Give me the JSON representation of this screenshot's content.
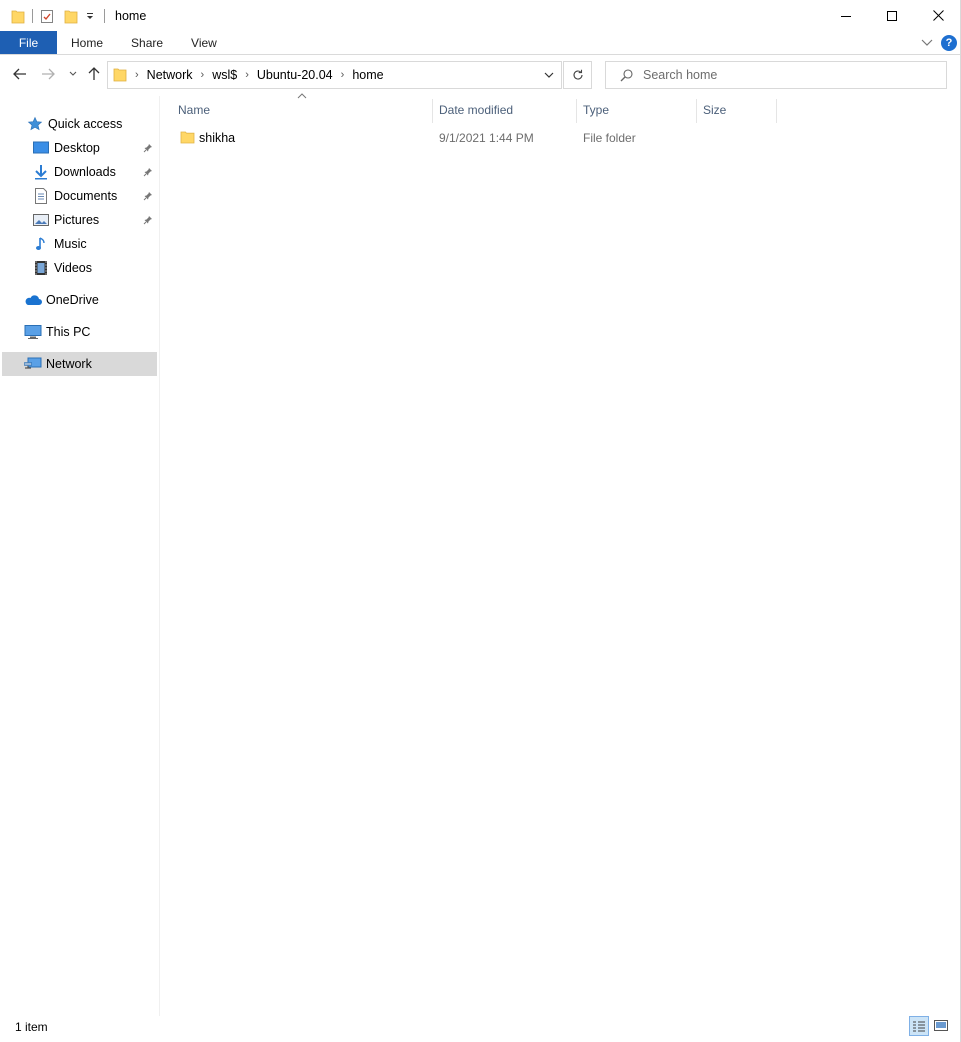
{
  "window": {
    "title": "home",
    "colors": {
      "file_tab": "#1e5fb3",
      "folder": "#ffd766",
      "selected_nav": "#d9d9d9",
      "header_text": "#4c607a"
    }
  },
  "ribbon": {
    "tabs": [
      "File",
      "Home",
      "Share",
      "View"
    ],
    "help_label": "?"
  },
  "address": {
    "crumbs": [
      "Network",
      "wsl$",
      "Ubuntu-20.04",
      "home"
    ]
  },
  "search": {
    "placeholder": "Search home"
  },
  "nav": {
    "quick_access": "Quick access",
    "items": [
      {
        "label": "Desktop",
        "icon": "desktop-icon",
        "pinned": true
      },
      {
        "label": "Downloads",
        "icon": "downloads-icon",
        "pinned": true
      },
      {
        "label": "Documents",
        "icon": "documents-icon",
        "pinned": true
      },
      {
        "label": "Pictures",
        "icon": "pictures-icon",
        "pinned": true
      },
      {
        "label": "Music",
        "icon": "music-icon",
        "pinned": false
      },
      {
        "label": "Videos",
        "icon": "videos-icon",
        "pinned": false
      }
    ],
    "onedrive": "OneDrive",
    "this_pc": "This PC",
    "network": "Network"
  },
  "columns": [
    "Name",
    "Date modified",
    "Type",
    "Size"
  ],
  "files": [
    {
      "name": "shikha",
      "date": "9/1/2021 1:44 PM",
      "type": "File folder",
      "size": ""
    }
  ],
  "status": {
    "count": "1 item"
  }
}
